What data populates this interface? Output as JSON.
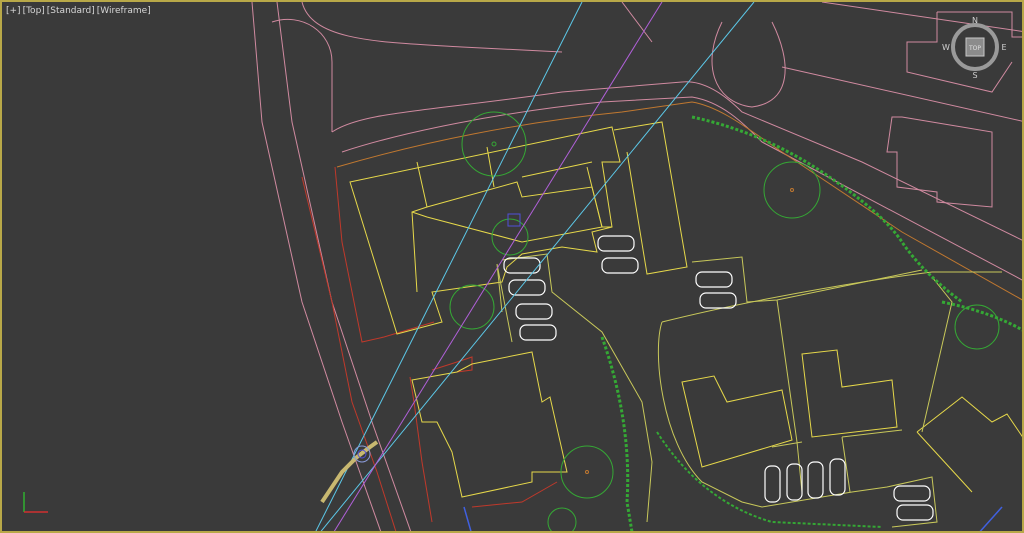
{
  "viewport": {
    "label_parts": [
      "[+]",
      "[Top]",
      "[Standard]",
      "[Wireframe]"
    ],
    "border_color": "#b8a848",
    "background": "#3a3a3a"
  },
  "viewcube": {
    "face_label": "TOP",
    "compass": {
      "north": "N",
      "south": "S",
      "east": "E",
      "west": "W"
    }
  },
  "colors": {
    "boundary": "#c0392b",
    "road": "#d08aa0",
    "building_yellow": "#e6d84a",
    "building_pink": "#e07090",
    "vegetation": "#35a835",
    "cars": "#ffffff",
    "camera_cyan": "#5cc8e8",
    "camera_violet": "#b060d8",
    "camera_target": "#5050d8",
    "orange_line": "#c07830",
    "axis_x": "#d03030",
    "axis_y": "#30b030"
  },
  "icons": {
    "viewcube": "viewcube-icon",
    "axis_tripod": "axis-tripod-icon",
    "camera": "camera-icon",
    "car": "car-icon",
    "tree": "tree-icon"
  }
}
